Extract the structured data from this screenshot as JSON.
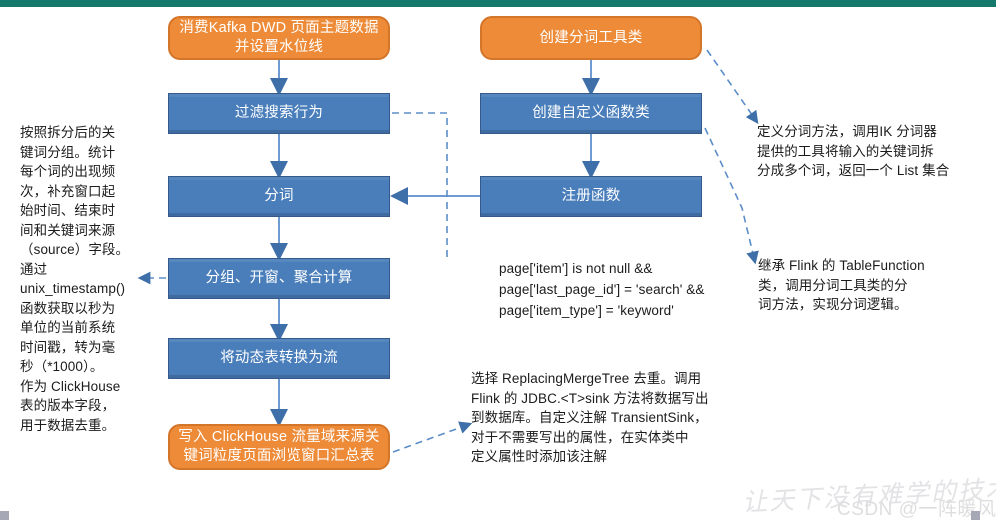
{
  "page": {
    "top_bar_color": "#14796b",
    "background": "#ffffff"
  },
  "palette": {
    "blue_fill": "#4a7ebb",
    "blue_border": "#35598a",
    "orange_fill": "#ed8b38",
    "orange_border": "#d4762a",
    "connector": "#4a7ebb",
    "text_dark": "#1b1b1b"
  },
  "flow": {
    "left_column": [
      {
        "id": "kafka-source",
        "type": "orange",
        "label": "消费Kafka DWD 页面主题数据\n并设置水位线"
      },
      {
        "id": "filter-search",
        "type": "blue",
        "label": "过滤搜索行为"
      },
      {
        "id": "word-split",
        "type": "blue",
        "label": "分词"
      },
      {
        "id": "group-window-agg",
        "type": "blue",
        "label": "分组、开窗、聚合计算"
      },
      {
        "id": "table-to-stream",
        "type": "blue",
        "label": "将动态表转换为流"
      },
      {
        "id": "sink-clickhouse",
        "type": "orange",
        "label": "写入 ClickHouse 流量域来源关\n键词粒度页面浏览窗口汇总表"
      }
    ],
    "right_column": [
      {
        "id": "create-split-util",
        "type": "orange",
        "label": "创建分词工具类"
      },
      {
        "id": "create-udf-class",
        "type": "blue",
        "label": "创建自定义函数类"
      },
      {
        "id": "register-function",
        "type": "blue",
        "label": "注册函数"
      }
    ]
  },
  "annotations": {
    "left_note": "按照拆分后的关\n键词分组。统计\n每个词的出现频\n次，补充窗口起\n始时间、结束时\n间和关键词来源\n（source）字段。\n通过\nunix_timestamp()\n函数获取以秒为\n单位的当前系统\n时间戳，转为毫\n秒（*1000）。\n作为 ClickHouse\n表的版本字段，\n用于数据去重。",
    "filter_condition": "page['item'] is not null &&\npage['last_page_id'] = 'search' &&\npage['item_type'] = 'keyword'",
    "split_method_note": "定义分词方法，调用IK 分词器\n提供的工具将输入的关键词拆\n分成多个词，返回一个 List 集合",
    "table_function_note": "继承 Flink 的 TableFunction\n类，调用分词工具类的分\n词方法，实现分词逻辑。",
    "sink_note": "选择 ReplacingMergeTree 去重。调用\nFlink 的 JDBC.<T>sink 方法将数据写出\n到数据库。自定义注解 TransientSink，\n对于不需要写出的属性，在实体类中\n定义属性时添加该注解"
  },
  "watermarks": {
    "brush": "让天下没有难学的技术",
    "csdn": "CSDN @一阵暖风"
  }
}
